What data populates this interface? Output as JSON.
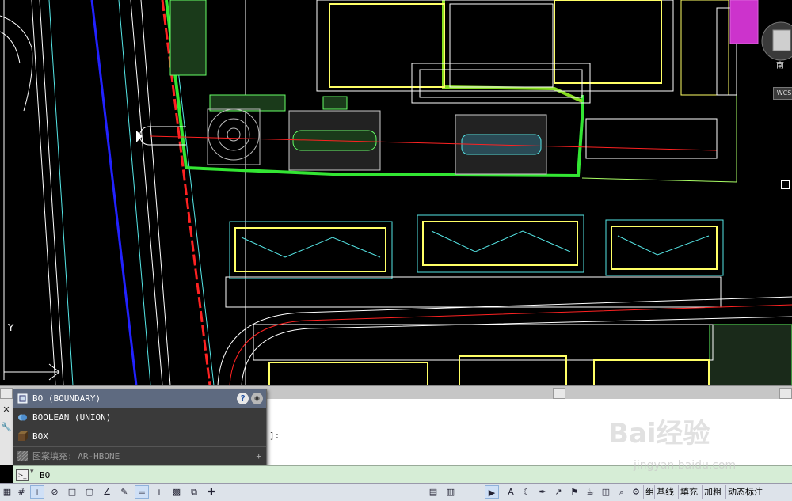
{
  "canvas": {
    "navcube_label": "南",
    "wcs_label": "WCS",
    "ucs_y_label": "Y",
    "colors": {
      "boundary_green": "#33e633",
      "road_blue": "#2222ff",
      "center_red": "#ff2222",
      "building_yellow": "#ffff66",
      "building_cyan": "#55e6e6",
      "hatch_magenta": "#cc33cc"
    }
  },
  "autocomplete": {
    "items": [
      {
        "label": "BO (BOUNDARY)",
        "icon": "boundary-icon"
      },
      {
        "label": "BOOLEAN (UNION)",
        "icon": "union-icon"
      },
      {
        "label": "BOX",
        "icon": "box-icon"
      },
      {
        "label": "图案填充: AR-HBONE",
        "icon": "hatch-icon"
      }
    ],
    "help_glyph": "?",
    "plus_glyph": "+"
  },
  "history": {
    "text": "]:"
  },
  "commandline": {
    "value": "BO"
  },
  "statusbar": {
    "labels": [
      "组",
      "基线",
      "填充",
      "加粗",
      "动态标注"
    ]
  },
  "watermark": {
    "brand": "Bai经验",
    "url": "jingyan.baidu.com"
  }
}
